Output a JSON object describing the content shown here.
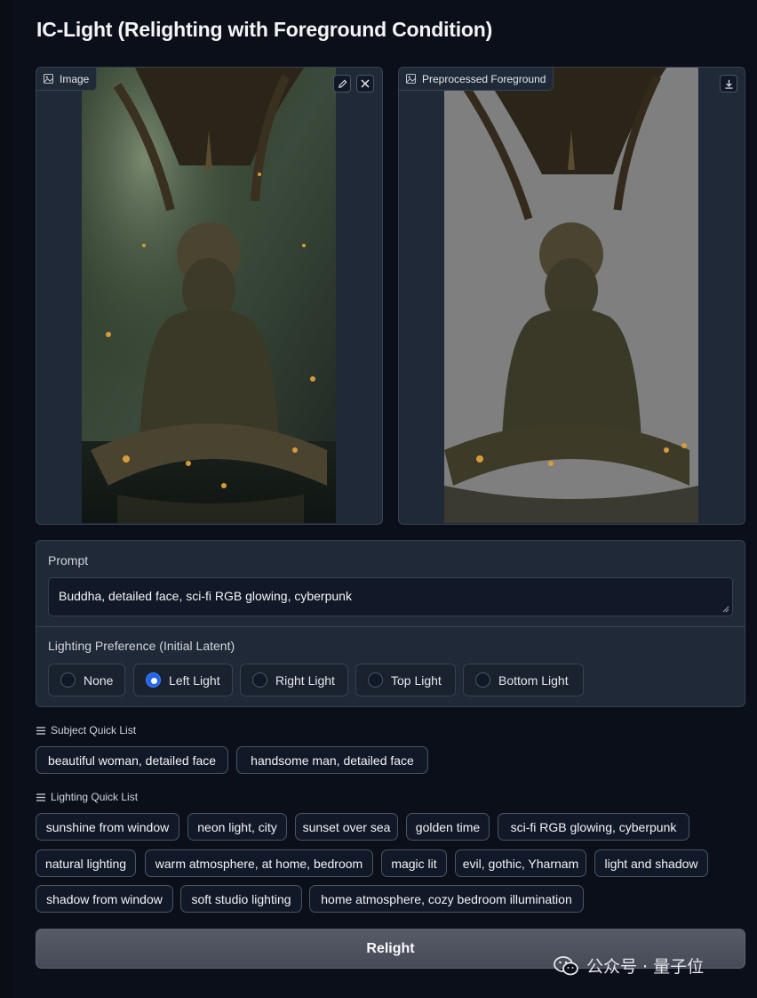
{
  "app": {
    "title": "IC-Light (Relighting with Foreground Condition)"
  },
  "image_panel": {
    "label": "Image",
    "edit_icon": "pencil-icon",
    "clear_icon": "close-icon"
  },
  "foreground_panel": {
    "label": "Preprocessed Foreground",
    "download_icon": "download-icon"
  },
  "prompt": {
    "label": "Prompt",
    "value": "Buddha, detailed face, sci-fi RGB glowing, cyberpunk"
  },
  "lighting_preference": {
    "label": "Lighting Preference (Initial Latent)",
    "selected": "Left Light",
    "options": [
      "None",
      "Left Light",
      "Right Light",
      "Top Light",
      "Bottom Light"
    ]
  },
  "subject_quick_list": {
    "label": "Subject Quick List",
    "items": [
      "beautiful woman, detailed face",
      "handsome man, detailed face"
    ]
  },
  "lighting_quick_list": {
    "label": "Lighting Quick List",
    "items": [
      "sunshine from window",
      "neon light, city",
      "sunset over sea",
      "golden time",
      "sci-fi RGB glowing, cyberpunk",
      "natural lighting",
      "warm atmosphere, at home, bedroom",
      "magic lit",
      "evil, gothic, Yharnam",
      "light and shadow",
      "shadow from window",
      "soft studio lighting",
      "home atmosphere, cozy bedroom illumination"
    ]
  },
  "relight_button": {
    "label": "Relight"
  },
  "watermark": {
    "text": "公众号 · 量子位",
    "icon": "wechat-icon"
  },
  "colors": {
    "background": "#0b0f19",
    "panel": "#1f2937",
    "accent": "#2563eb",
    "button": "#4b505b"
  }
}
